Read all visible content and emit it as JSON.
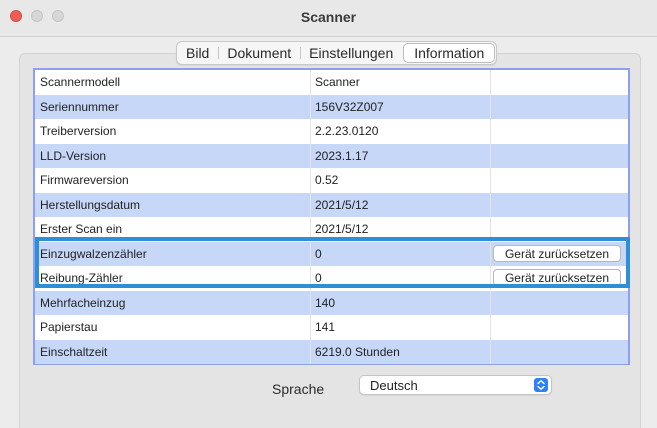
{
  "window": {
    "title": "Scanner"
  },
  "tabs": [
    {
      "label": "Bild",
      "active": false
    },
    {
      "label": "Dokument",
      "active": false
    },
    {
      "label": "Einstellungen",
      "active": false
    },
    {
      "label": "Information",
      "active": true
    }
  ],
  "info_table": {
    "rows": [
      {
        "label": "Scannermodell",
        "value": "Scanner"
      },
      {
        "label": "Seriennummer",
        "value": "156V32Z007"
      },
      {
        "label": "Treiberversion",
        "value": "2.2.23.0120"
      },
      {
        "label": "LLD-Version",
        "value": "2023.1.17"
      },
      {
        "label": "Firmwareversion",
        "value": "0.52"
      },
      {
        "label": "Herstellungsdatum",
        "value": "2021/5/12"
      },
      {
        "label": "Erster Scan ein",
        "value": "2021/5/12"
      },
      {
        "label": "Einzugwalzenzähler",
        "value": "0",
        "action": "Gerät zurücksetzen"
      },
      {
        "label": "Reibung-Zähler",
        "value": "0",
        "action": "Gerät zurücksetzen"
      },
      {
        "label": "Mehrfacheinzug",
        "value": "140"
      },
      {
        "label": "Papierstau",
        "value": "141"
      },
      {
        "label": "Einschaltzeit",
        "value": "6219.0 Stunden"
      }
    ]
  },
  "language": {
    "label": "Sprache",
    "selected": "Deutsch"
  },
  "colors": {
    "row_alt": "#c7d7f8",
    "table_border": "#8e9ff0",
    "highlight_border": "#2e8fd5",
    "stepper": "#2f82f4"
  }
}
